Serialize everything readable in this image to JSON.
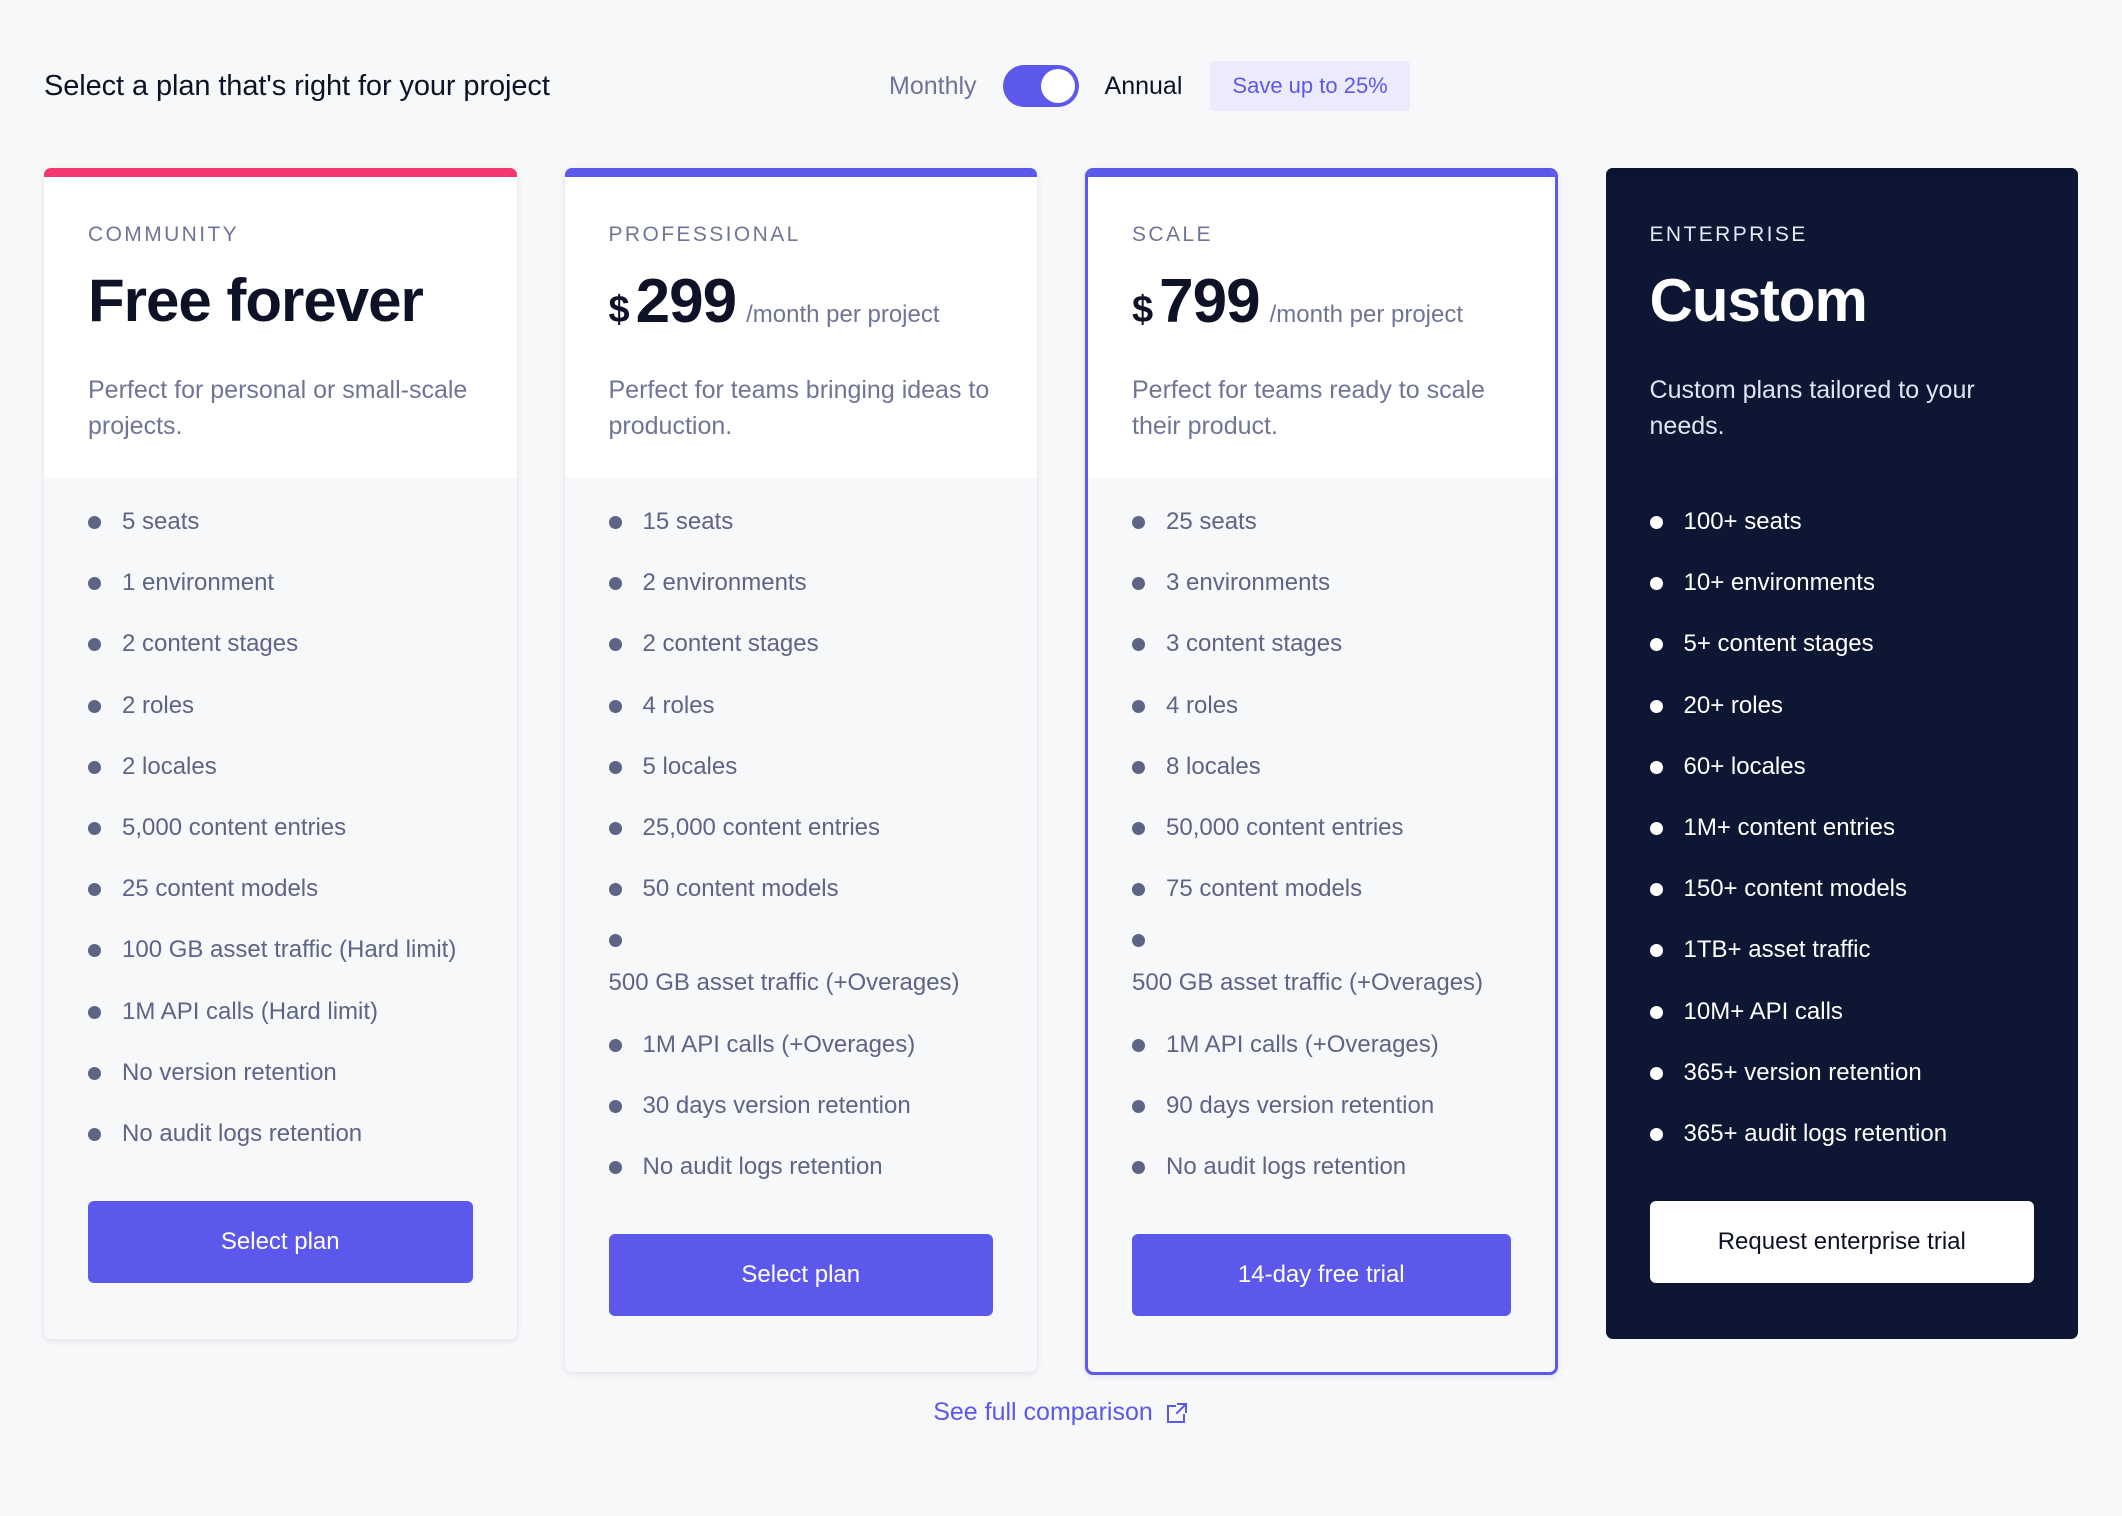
{
  "header": {
    "title": "Select a plan that's right for your project",
    "toggle": {
      "monthly_label": "Monthly",
      "annual_label": "Annual",
      "state": "annual",
      "save_badge": "Save up to 25%"
    }
  },
  "colors": {
    "accent": "#5b58eb",
    "community_stripe": "#f2386f",
    "enterprise_bg": "#0d1733",
    "page_bg": "#f7f8fa",
    "badge_bg": "#eceafd"
  },
  "plans": [
    {
      "name": "COMMUNITY",
      "stripe_color": "#f2386f",
      "currency": "",
      "price": "Free forever",
      "period": "",
      "description": "Perfect for personal or small-scale projects.",
      "bullet_color": "#f2386f",
      "features": [
        "5 seats",
        "1 environment",
        "2 content stages",
        "2 roles",
        "2 locales",
        "5,000 content entries",
        "25 content models",
        "100 GB asset traffic (Hard limit)",
        "1M API calls (Hard limit)",
        "No version retention",
        "No audit logs retention"
      ],
      "cta_label": "Select plan"
    },
    {
      "name": "PROFESSIONAL",
      "stripe_color": "#5b58eb",
      "currency": "$",
      "price": "299",
      "period": "/month per project",
      "description": "Perfect for teams bringing ideas to production.",
      "bullet_color": "#5b58eb",
      "features": [
        "15 seats",
        "2 environments",
        "2 content stages",
        "4 roles",
        "5 locales",
        "25,000 content entries",
        "50 content models",
        "500 GB asset traffic (+Overages)",
        "1M API calls (+Overages)",
        "30 days version retention",
        "No audit logs retention"
      ],
      "cta_label": "Select plan"
    },
    {
      "name": "SCALE",
      "stripe_color": "#5b58eb",
      "currency": "$",
      "price": "799",
      "period": "/month per project",
      "description": "Perfect for teams ready to scale their product.",
      "bullet_color": "#5b58eb",
      "features": [
        "25 seats",
        "3 environments",
        "3 content stages",
        "4 roles",
        "8 locales",
        "50,000 content entries",
        "75 content models",
        "500 GB asset traffic (+Overages)",
        "1M API calls (+Overages)",
        "90 days version retention",
        "No audit logs retention"
      ],
      "cta_label": "14-day free trial"
    },
    {
      "name": "ENTERPRISE",
      "stripe_color": "#0b1430",
      "currency": "",
      "price": "Custom",
      "period": "",
      "description": "Custom plans tailored to your needs.",
      "bullet_color": "#ffffff",
      "features": [
        "100+ seats",
        "10+ environments",
        "5+ content stages",
        "20+ roles",
        "60+ locales",
        "1M+ content entries",
        "150+ content models",
        "1TB+ asset traffic",
        "10M+ API calls",
        "365+ version retention",
        "365+ audit logs retention"
      ],
      "cta_label": "Request enterprise trial"
    }
  ],
  "footer": {
    "link_label": "See full comparison",
    "icon": "external-link-icon"
  }
}
